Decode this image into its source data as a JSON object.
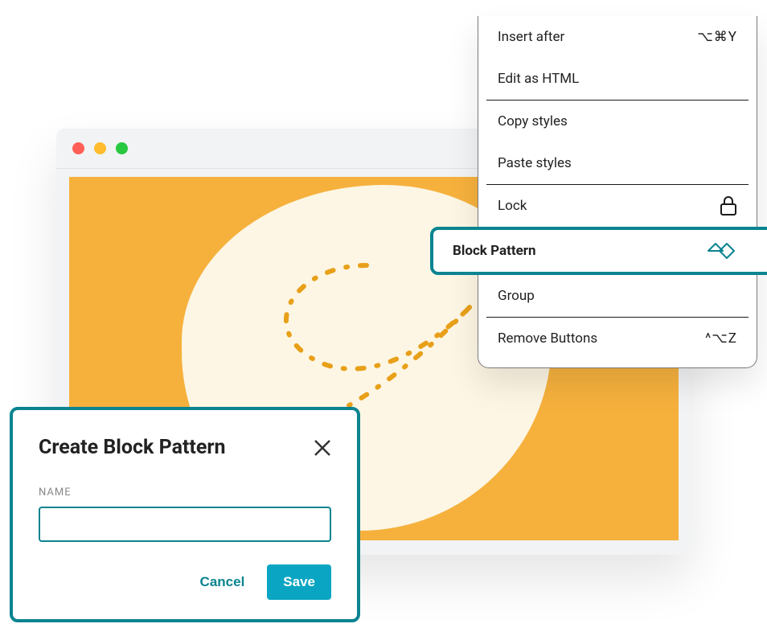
{
  "menu": {
    "insert_after": {
      "label": "Insert after",
      "shortcut": "⌥⌘Y"
    },
    "edit_html": {
      "label": "Edit as HTML"
    },
    "copy_styles": {
      "label": "Copy styles"
    },
    "paste_styles": {
      "label": "Paste styles"
    },
    "lock": {
      "label": "Lock"
    },
    "block_pattern": {
      "label": "Block Pattern"
    },
    "group": {
      "label": "Group"
    },
    "remove": {
      "label": "Remove Buttons",
      "shortcut": "^⌥Z"
    }
  },
  "dialog": {
    "title": "Create Block Pattern",
    "name_label": "NAME",
    "name_value": "",
    "cancel": "Cancel",
    "save": "Save"
  },
  "colors": {
    "accent": "#0b8490",
    "primary_button": "#0aa5c2",
    "canvas_bg": "#f6b13d",
    "blob": "#fdf6e4"
  }
}
